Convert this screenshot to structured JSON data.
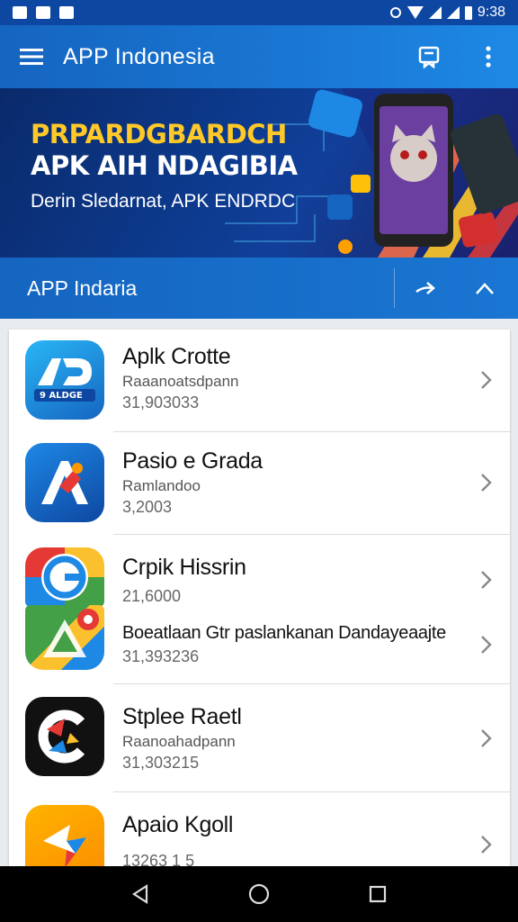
{
  "status_bar": {
    "time": "9:38"
  },
  "app_bar": {
    "title": "APP Indonesia",
    "icons": [
      "menu-icon",
      "bookmark-icon",
      "more-vert-icon"
    ]
  },
  "banner": {
    "headline": "PRPARDGBARDCH",
    "subheadline": "APK AIH NDAGIBIA",
    "tagline": "Derin Sledarnat, APK ENDRDC"
  },
  "section": {
    "title": "APP Indaria",
    "icons": [
      "arrow-right-icon",
      "collapse-icon"
    ]
  },
  "apps": [
    {
      "title": "Aplk Crotte",
      "subtitle": "Raaanoatsdpann",
      "meta": "31,903033",
      "icon_label": "9 ALDGE",
      "icon": "app-icon-ad"
    },
    {
      "title": "Pasio e Grada",
      "subtitle": "Ramlandoo",
      "meta": "3,2003",
      "icon": "app-icon-a"
    },
    {
      "title": "Crpik Hissrin",
      "subtitle": "",
      "meta": "21,6000",
      "icon": "app-icon-g"
    },
    {
      "title": "Boeatlaan Gtr paslankanan Dandayeaajte",
      "subtitle": "",
      "meta": "31,393236",
      "icon": "app-icon-drive"
    },
    {
      "title": "Stplee Raetl",
      "subtitle": "Raanoahadpann",
      "meta": "31,303215",
      "icon": "app-icon-c"
    },
    {
      "title": "Apaio Kgoll",
      "subtitle": "",
      "meta": "13263 1 5",
      "icon": "app-icon-k"
    }
  ],
  "nav_bar": {
    "icons": [
      "back-icon",
      "home-icon",
      "recents-icon"
    ]
  },
  "colors": {
    "primary": "#1976d2",
    "primary_dark": "#0d47a1",
    "banner_yellow": "#ffc928"
  }
}
